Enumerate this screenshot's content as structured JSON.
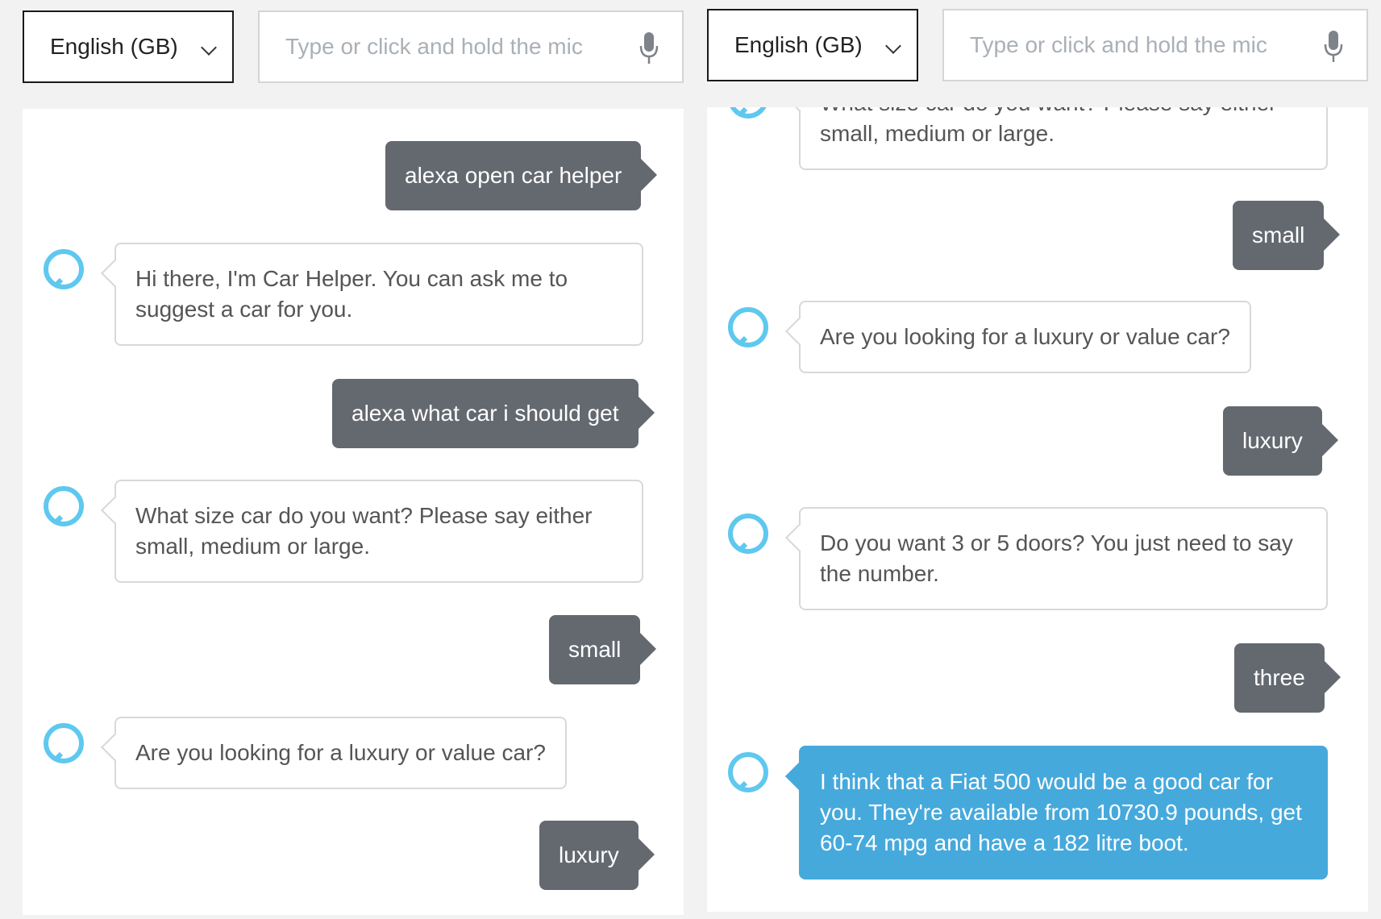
{
  "left": {
    "language": "English (GB)",
    "input_placeholder": "Type or click and hold the mic",
    "messages": [
      {
        "role": "user",
        "text": "alexa open car helper"
      },
      {
        "role": "bot",
        "text": "Hi there, I'm Car Helper. You can ask me to suggest a car for you."
      },
      {
        "role": "user",
        "text": "alexa what car i should get"
      },
      {
        "role": "bot",
        "text": "What size car do you want? Please say either small, medium or large."
      },
      {
        "role": "user",
        "text": "small"
      },
      {
        "role": "bot",
        "text": "Are you looking for a luxury or value car?"
      },
      {
        "role": "user",
        "text": "luxury"
      }
    ]
  },
  "right": {
    "language": "English (GB)",
    "input_placeholder": "Type or click and hold the mic",
    "messages": [
      {
        "role": "bot",
        "text": "What size car do you want? Please say either small, medium or large."
      },
      {
        "role": "user",
        "text": "small"
      },
      {
        "role": "bot",
        "text": "Are you looking for a luxury or value car?"
      },
      {
        "role": "user",
        "text": "luxury"
      },
      {
        "role": "bot",
        "text": "Do you want 3 or 5 doors? You just need to say the number."
      },
      {
        "role": "user",
        "text": "three"
      },
      {
        "role": "bot",
        "text": "I think that a Fiat 500 would be a good car for you. They're available from 10730.9 pounds, get 60-74 mpg and have a 182 litre boot."
      }
    ]
  },
  "colors": {
    "user_bubble": "#646970",
    "final_bot_bubble": "#46a9dc",
    "avatar_ring": "#5fc8ef"
  }
}
